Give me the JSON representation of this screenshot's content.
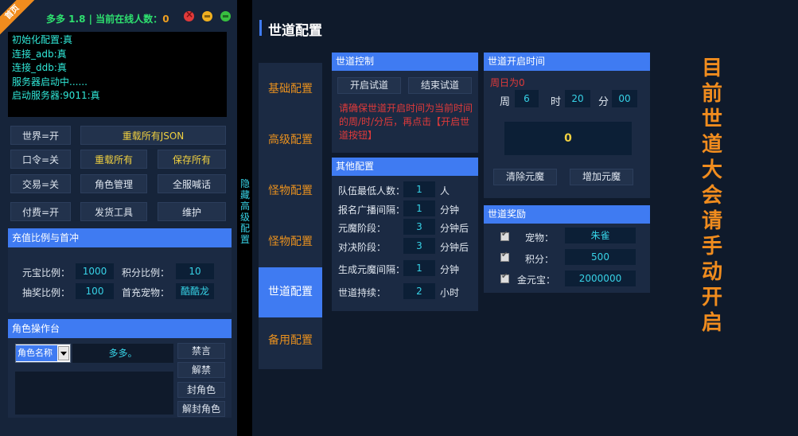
{
  "app": {
    "ribbon": "首页",
    "title": "多多 1.8 | 当前在线人数：",
    "online_count": "0"
  },
  "console_lines": [
    "初始化配置:真",
    "连接_adb:真",
    "连接_ddb:真",
    "服务器启动中......",
    "启动服务器:9011:真"
  ],
  "left_buttons": {
    "world": "世界=开",
    "reload_json": "重载所有JSON",
    "command": "口令=关",
    "reload_all": "重载所有",
    "save_all": "保存所有",
    "trade": "交易=关",
    "role_mgmt": "角色管理",
    "broadcast": "全服喊话",
    "paid": "付费=开",
    "send_tool": "发货工具",
    "maintain": "维护"
  },
  "recharge": {
    "header": "充值比例与首冲",
    "yuanbao_label": "元宝比例：",
    "yuanbao_value": "1000",
    "points_label": "积分比例：",
    "points_value": "10",
    "lottery_label": "抽奖比例：",
    "lottery_value": "100",
    "first_pet_label": "首充宠物：",
    "first_pet_value": "酷酷龙"
  },
  "role_ops": {
    "header": "角色操作台",
    "select_value": "角色名称",
    "name_value": "多多。",
    "mute": "禁言",
    "unmute": "解禁",
    "ban": "封角色",
    "unban": "解封角色"
  },
  "strip_text": "隐藏高级配置",
  "page": {
    "title": "世道配置"
  },
  "nav": [
    "基础配置",
    "高级配置",
    "怪物配置",
    "怪物配置",
    "世道配置",
    "备用配置"
  ],
  "nav_active_index": 4,
  "world_control": {
    "header": "世道控制",
    "start_trial": "开启试道",
    "end_trial": "结束试道",
    "note": "请确保世道开启时间为当前时间的周/时/分后，再点击【开启世道按钮】"
  },
  "other_config": {
    "header": "其他配置",
    "rows": [
      {
        "label": "队伍最低人数：",
        "value": "1",
        "unit": "人"
      },
      {
        "label": "报名广播间隔：",
        "value": "1",
        "unit": "分钟"
      },
      {
        "label": "元魔阶段：",
        "value": "3",
        "unit": "分钟后"
      },
      {
        "label": "对决阶段：",
        "value": "3",
        "unit": "分钟后"
      },
      {
        "label": "生成元魔间隔：",
        "value": "1",
        "unit": "分钟"
      },
      {
        "label": "世道持续：",
        "value": "2",
        "unit": "小时"
      }
    ]
  },
  "world_time": {
    "header": "世道开启时间",
    "note": "周日为0",
    "week_label": "周",
    "week_value": "6",
    "hour_label": "时",
    "hour_value": "20",
    "minute_label": "分",
    "minute_value": "00",
    "counter": "0",
    "clear": "清除元魔",
    "add": "增加元魔"
  },
  "world_reward": {
    "header": "世道奖励",
    "rows": [
      {
        "label": "宠物：",
        "value": "朱雀",
        "checked": true
      },
      {
        "label": "积分：",
        "value": "500",
        "checked": true
      },
      {
        "label": "金元宝：",
        "value": "2000000",
        "checked": true
      }
    ]
  },
  "notice": "目前世道大会请手动开启",
  "colors": {
    "accent": "#3f7bf2",
    "orange": "#f08c1e",
    "cyan": "#37d2e6",
    "green": "#2ee06f"
  }
}
